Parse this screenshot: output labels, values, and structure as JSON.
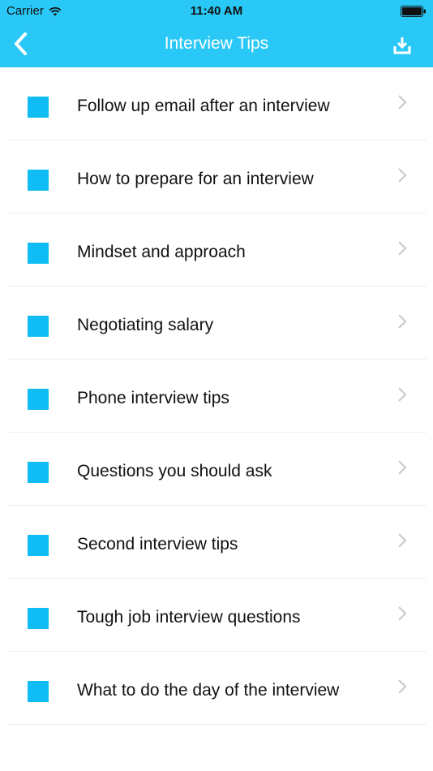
{
  "status_bar": {
    "carrier": "Carrier",
    "time": "11:40 AM"
  },
  "nav": {
    "title": "Interview Tips",
    "accent_color": "#2ac8f6"
  },
  "list": {
    "square_color": "#0fbdf4",
    "items": [
      {
        "label": "Follow up email after an interview"
      },
      {
        "label": "How to prepare for an interview"
      },
      {
        "label": "Mindset and approach"
      },
      {
        "label": "Negotiating salary"
      },
      {
        "label": "Phone interview tips"
      },
      {
        "label": "Questions you should ask"
      },
      {
        "label": "Second interview tips"
      },
      {
        "label": "Tough job interview questions"
      },
      {
        "label": "What to do the day of the interview"
      }
    ]
  }
}
